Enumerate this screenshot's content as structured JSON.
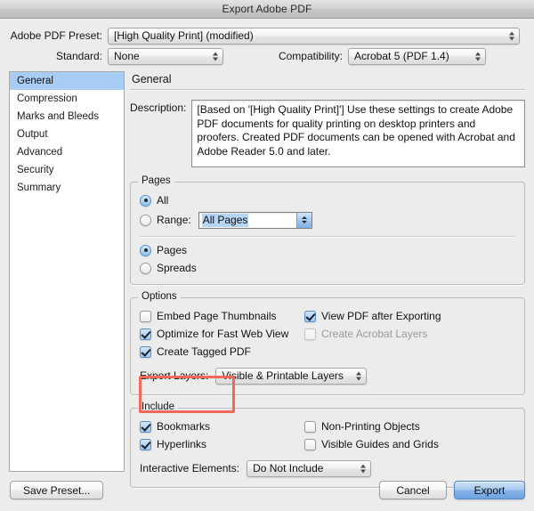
{
  "window": {
    "title": "Export Adobe PDF"
  },
  "top": {
    "preset_label": "Adobe PDF Preset:",
    "preset_value": "[High Quality Print] (modified)",
    "standard_label": "Standard:",
    "standard_value": "None",
    "compatibility_label": "Compatibility:",
    "compatibility_value": "Acrobat 5 (PDF 1.4)"
  },
  "sidebar": {
    "items": [
      {
        "label": "General",
        "selected": true
      },
      {
        "label": "Compression",
        "selected": false
      },
      {
        "label": "Marks and Bleeds",
        "selected": false
      },
      {
        "label": "Output",
        "selected": false
      },
      {
        "label": "Advanced",
        "selected": false
      },
      {
        "label": "Security",
        "selected": false
      },
      {
        "label": "Summary",
        "selected": false
      }
    ]
  },
  "pane": {
    "title": "General",
    "description_label": "Description:",
    "description_value": "[Based on '[High Quality Print]'] Use these settings to create Adobe PDF documents for quality printing on desktop printers and proofers.  Created PDF documents can be opened with Acrobat and Adobe Reader 5.0 and later."
  },
  "pages": {
    "group_title": "Pages",
    "all_label": "All",
    "range_label": "Range:",
    "range_value": "All Pages",
    "pages_label": "Pages",
    "spreads_label": "Spreads"
  },
  "options": {
    "group_title": "Options",
    "embed_thumbnails_label": "Embed Page Thumbnails",
    "optimize_label": "Optimize for Fast Web View",
    "tagged_pdf_label": "Create Tagged PDF",
    "view_pdf_label": "View PDF after Exporting",
    "acrobat_layers_label": "Create Acrobat Layers",
    "export_layers_label": "Export Layers:",
    "export_layers_value": "Visible & Printable Layers"
  },
  "include": {
    "group_title": "Include",
    "bookmarks_label": "Bookmarks",
    "hyperlinks_label": "Hyperlinks",
    "non_printing_label": "Non-Printing Objects",
    "guides_grids_label": "Visible Guides and Grids",
    "interactive_label": "Interactive Elements:",
    "interactive_value": "Do Not Include"
  },
  "footer": {
    "save_preset_label": "Save Preset...",
    "cancel_label": "Cancel",
    "export_label": "Export"
  },
  "annotation": {
    "highlight_color": "#f2695c"
  }
}
